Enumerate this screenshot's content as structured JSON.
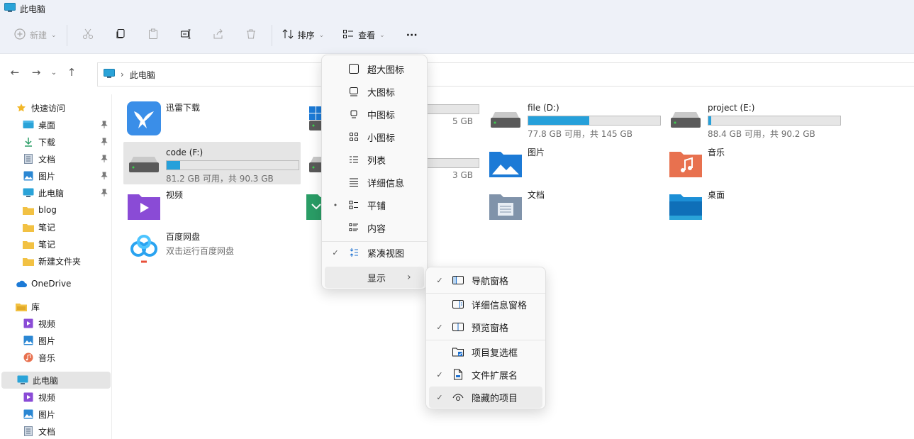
{
  "window": {
    "title": "此电脑"
  },
  "toolbar": {
    "new_label": "新建",
    "sort_label": "排序",
    "view_label": "查看",
    "more_label": "···"
  },
  "address": {
    "path": "此电脑",
    "separator": "›"
  },
  "sidebar": {
    "quick_access": "快速访问",
    "items": [
      {
        "label": "桌面",
        "icon": "desktop-icon",
        "pinned": true
      },
      {
        "label": "下载",
        "icon": "download-icon",
        "pinned": true
      },
      {
        "label": "文档",
        "icon": "document-icon",
        "pinned": true
      },
      {
        "label": "图片",
        "icon": "picture-icon",
        "pinned": true
      },
      {
        "label": "此电脑",
        "icon": "computer-icon",
        "pinned": true
      },
      {
        "label": "blog",
        "icon": "folder-icon"
      },
      {
        "label": "笔记",
        "icon": "folder-icon"
      },
      {
        "label": "笔记",
        "icon": "folder-icon"
      },
      {
        "label": "新建文件夹",
        "icon": "folder-icon"
      }
    ],
    "onedrive": "OneDrive",
    "library": "库",
    "library_items": [
      {
        "label": "视频",
        "icon": "video-icon"
      },
      {
        "label": "图片",
        "icon": "picture-icon"
      },
      {
        "label": "音乐",
        "icon": "music-icon"
      }
    ],
    "this_pc": "此电脑",
    "this_pc_items": [
      {
        "label": "视频",
        "icon": "video-icon"
      },
      {
        "label": "图片",
        "icon": "picture-icon"
      },
      {
        "label": "文档",
        "icon": "document-icon"
      }
    ]
  },
  "tiles": {
    "xunlei": {
      "name": "迅雷下载"
    },
    "drive_c_partial": {
      "sub": "5 GB",
      "fill_pct": 0.6
    },
    "drive_d": {
      "name": "file (D:)",
      "sub": "77.8 GB 可用，共 145 GB",
      "fill_pct": 0.46
    },
    "drive_e": {
      "name": "project (E:)",
      "sub": "88.4 GB 可用，共 90.2 GB",
      "fill_pct": 0.02
    },
    "drive_f": {
      "name": "code (F:)",
      "sub": "81.2 GB 可用，共 90.3 GB",
      "fill_pct": 0.1
    },
    "drive_g_partial": {
      "sub": "3 GB",
      "fill_pct": 0.55
    },
    "pictures": {
      "name": "图片"
    },
    "music": {
      "name": "音乐"
    },
    "videos": {
      "name": "视频"
    },
    "documents": {
      "name": "文档"
    },
    "desktop": {
      "name": "桌面"
    },
    "baidu": {
      "name": "百度网盘",
      "sub": "双击运行百度网盘"
    }
  },
  "view_menu": {
    "items": [
      {
        "label": "超大图标",
        "icon": "extra-large-icons-icon",
        "mark": ""
      },
      {
        "label": "大图标",
        "icon": "large-icons-icon",
        "mark": ""
      },
      {
        "label": "中图标",
        "icon": "medium-icons-icon",
        "mark": ""
      },
      {
        "label": "小图标",
        "icon": "small-icons-icon",
        "mark": ""
      },
      {
        "label": "列表",
        "icon": "list-icon",
        "mark": ""
      },
      {
        "label": "详细信息",
        "icon": "details-icon",
        "mark": ""
      },
      {
        "label": "平铺",
        "icon": "tiles-icon",
        "mark": "•"
      },
      {
        "label": "内容",
        "icon": "content-icon",
        "mark": ""
      }
    ],
    "compact": {
      "label": "紧凑视图",
      "mark": "✓"
    },
    "show": {
      "label": "显示",
      "arrow": "›"
    }
  },
  "show_menu": {
    "items": [
      {
        "label": "导航窗格",
        "mark": "✓"
      },
      {
        "label": "详细信息窗格",
        "mark": ""
      },
      {
        "label": "预览窗格",
        "mark": "✓"
      },
      {
        "label": "项目复选框",
        "mark": ""
      },
      {
        "label": "文件扩展名",
        "mark": "✓"
      },
      {
        "label": "隐藏的项目",
        "mark": "✓"
      }
    ]
  },
  "colors": {
    "accent": "#26a0da",
    "folder": "#f2c143",
    "selected": "#e5e5e5"
  }
}
